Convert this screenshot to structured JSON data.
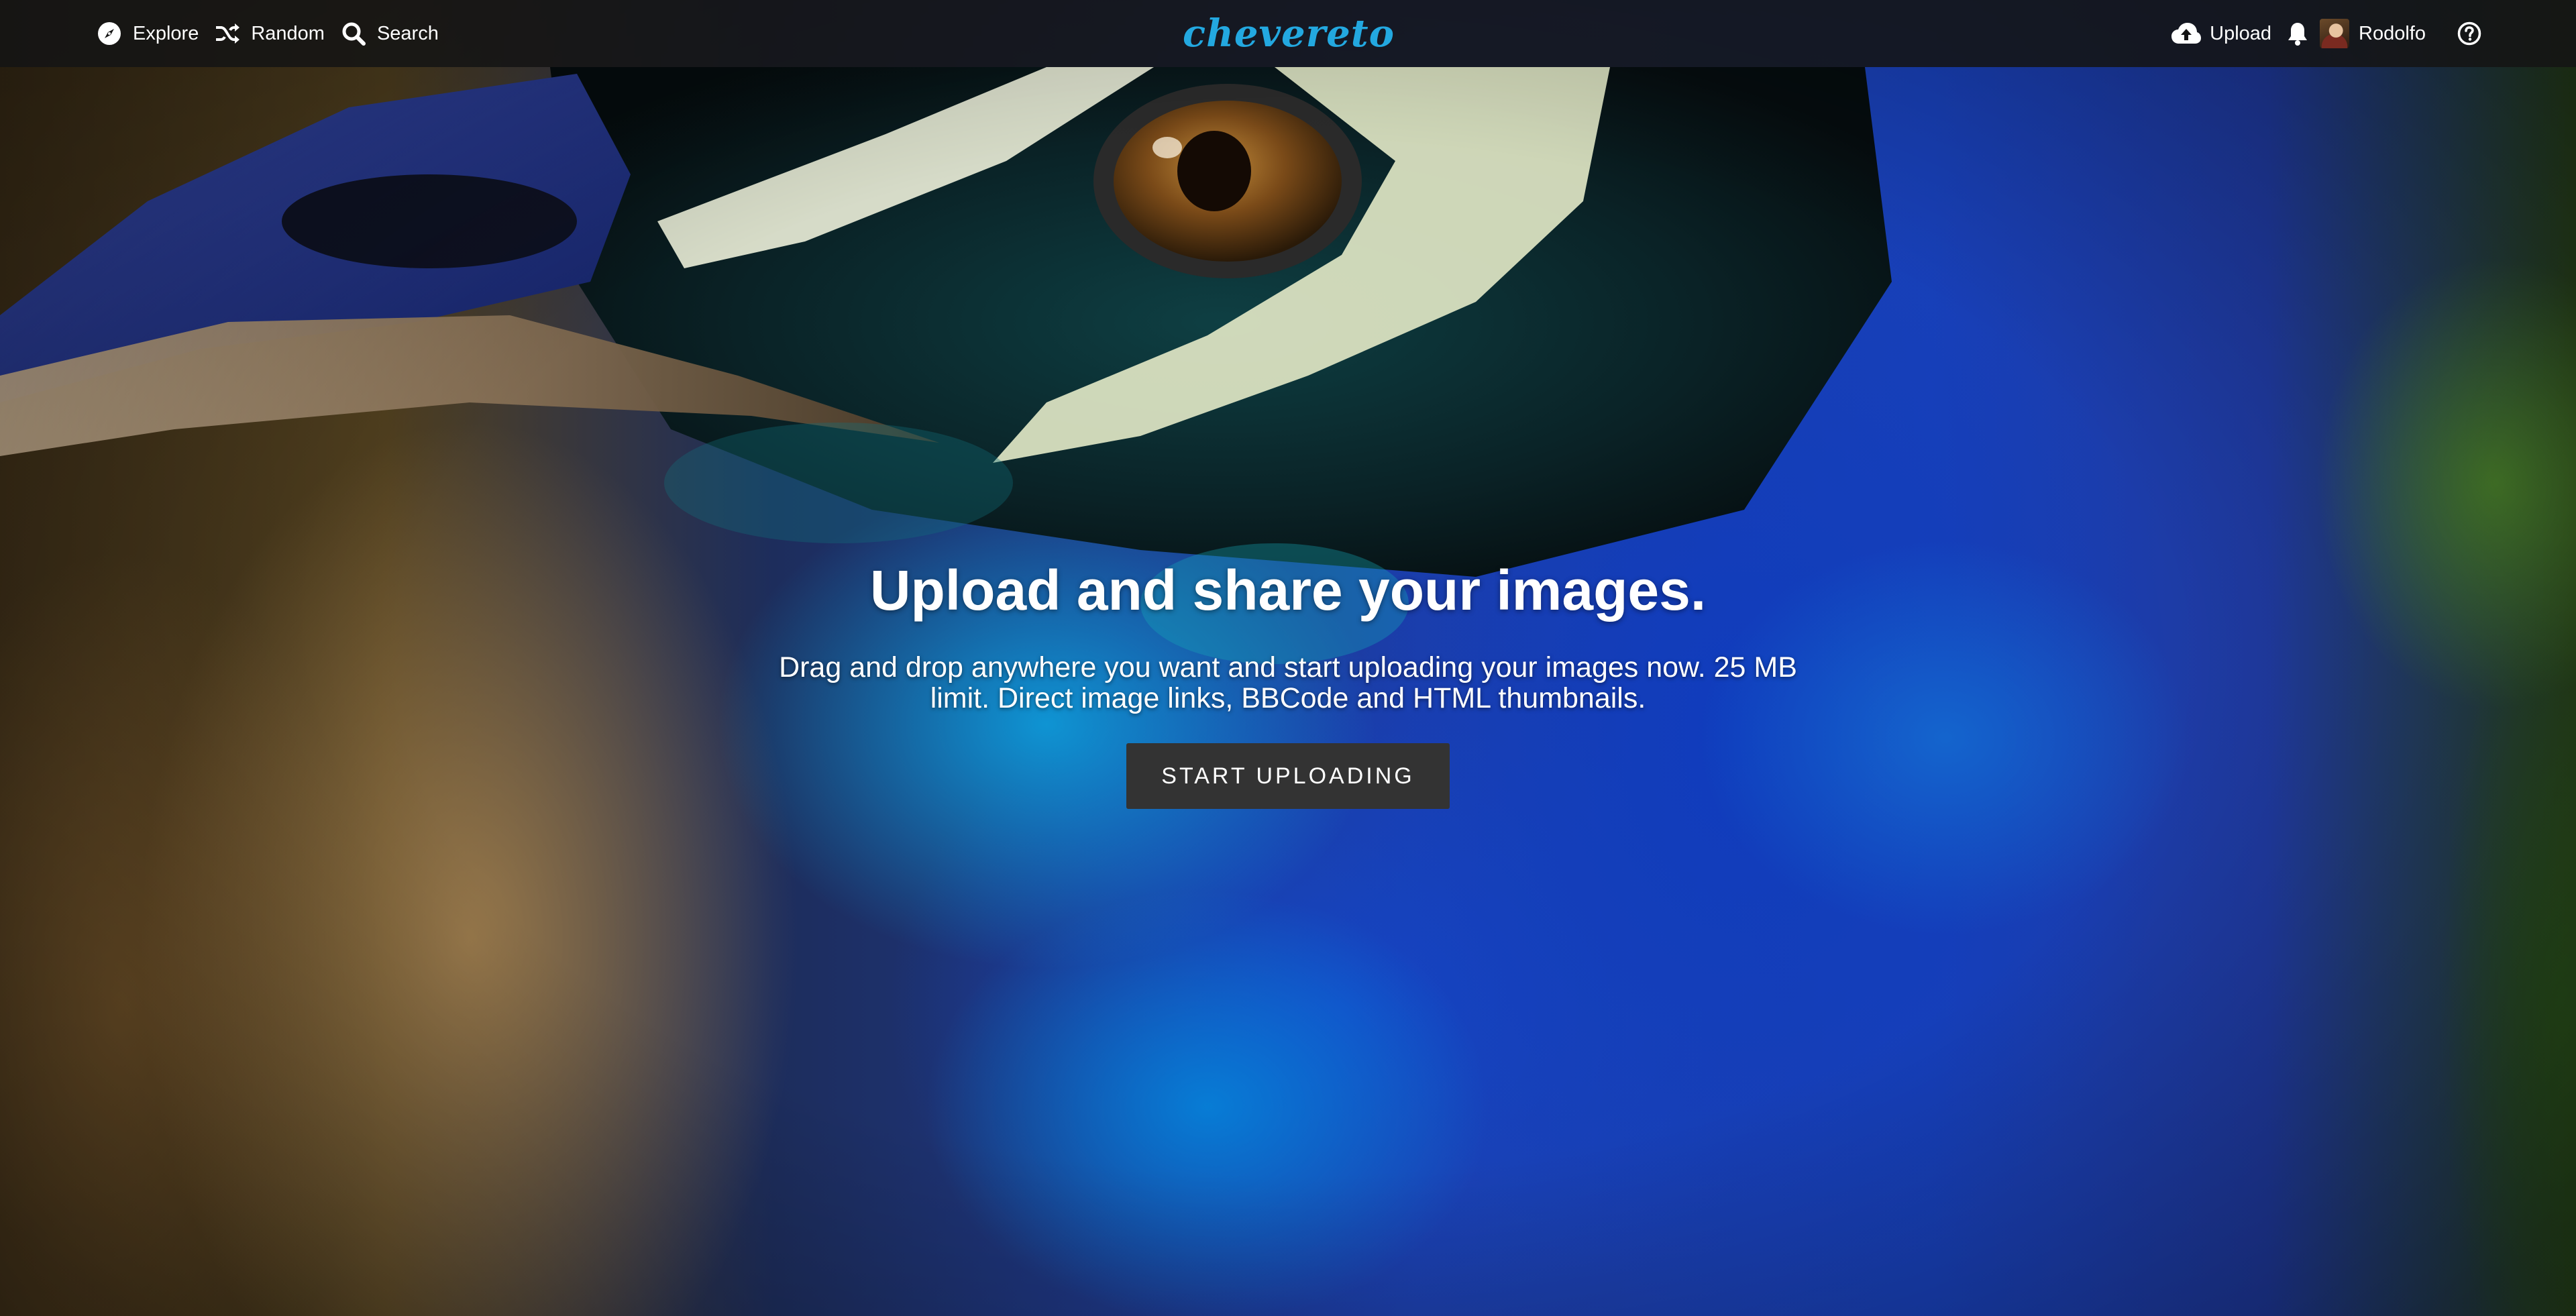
{
  "nav": {
    "left": [
      {
        "label": "Explore",
        "icon": "compass-icon"
      },
      {
        "label": "Random",
        "icon": "shuffle-icon"
      },
      {
        "label": "Search",
        "icon": "search-icon"
      }
    ],
    "logo_text": "chevereto",
    "upload_label": "Upload",
    "user_name": "Rodolfo",
    "icons": {
      "upload": "cloud-upload-icon",
      "notifications": "bell-icon",
      "help": "help-icon"
    }
  },
  "hero": {
    "title": "Upload and share your images.",
    "subtitle": "Drag and drop anywhere you want and start uploading your images now. 25 MB limit. Direct image links, BBCode and HTML thumbnails.",
    "cta_label": "START UPLOADING"
  },
  "colors": {
    "brand": "#23a8e0",
    "topbar": "#141414",
    "cta_background": "#333333"
  }
}
